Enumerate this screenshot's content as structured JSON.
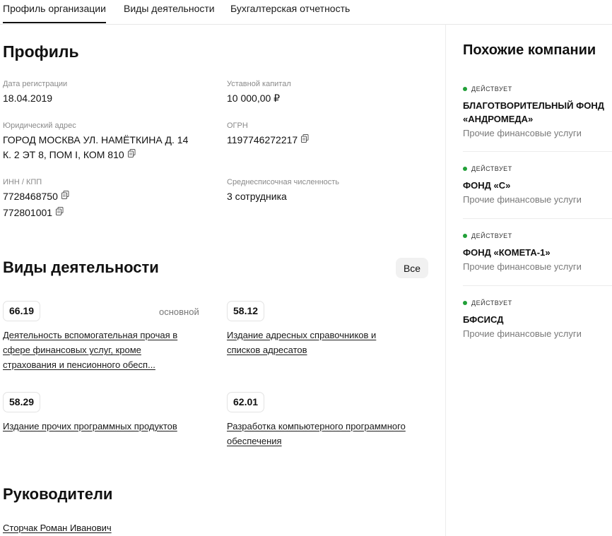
{
  "tabs": [
    {
      "label": "Профиль организации",
      "active": true
    },
    {
      "label": "Виды деятельности",
      "active": false
    },
    {
      "label": "Бухгалтерская отчетность",
      "active": false
    }
  ],
  "profile": {
    "title": "Профиль",
    "registration_date": {
      "label": "Дата регистрации",
      "value": "18.04.2019"
    },
    "capital": {
      "label": "Уставной капитал",
      "value": "10 000,00 ₽"
    },
    "address": {
      "label": "Юридический адрес",
      "line1": "ГОРОД МОСКВА УЛ. НАМЁТКИНА Д. 14",
      "line2": "К. 2 ЭТ 8, ПОМ I, КОМ 810"
    },
    "ogrn": {
      "label": "ОГРН",
      "value": "1197746272217"
    },
    "inn_kpp": {
      "label": "ИНН / КПП",
      "inn": "7728468750",
      "kpp": "772801001"
    },
    "headcount": {
      "label": "Среднесписочная численность",
      "value": "3 сотрудника"
    }
  },
  "activities": {
    "title": "Виды деятельности",
    "all_button": "Все",
    "main_tag": "основной",
    "items": [
      {
        "code": "66.19",
        "text": [
          "Деятельность вспомогательная прочая в",
          "сфере финансовых услуг, кроме",
          "страхования и пенсионного обесп..."
        ]
      },
      {
        "code": "58.12",
        "text": [
          "Издание адресных справочников и",
          "списков адресатов"
        ]
      },
      {
        "code": "58.29",
        "text": [
          "Издание прочих программных продуктов"
        ]
      },
      {
        "code": "62.01",
        "text": [
          "Разработка компьютерного программного",
          "обеспечения"
        ]
      }
    ]
  },
  "leaders": {
    "title": "Руководители",
    "people": [
      "Сторчак Роман Иванович"
    ]
  },
  "similar": {
    "title": "Похожие компании",
    "status_color": "#21a038",
    "companies": [
      {
        "status": "ДЕЙСТВУЕТ",
        "name_lines": [
          "БЛАГОТВОРИТЕЛЬНЫЙ ФОНД",
          "«АНДРОМЕДА»"
        ],
        "desc": "Прочие финансовые услуги"
      },
      {
        "status": "ДЕЙСТВУЕТ",
        "name_lines": [
          "ФОНД «С»"
        ],
        "desc": "Прочие финансовые услуги"
      },
      {
        "status": "ДЕЙСТВУЕТ",
        "name_lines": [
          "ФОНД «КОМЕТА-1»"
        ],
        "desc": "Прочие финансовые услуги"
      },
      {
        "status": "ДЕЙСТВУЕТ",
        "name_lines": [
          "БФСИСД"
        ],
        "desc": "Прочие финансовые услуги"
      }
    ]
  }
}
